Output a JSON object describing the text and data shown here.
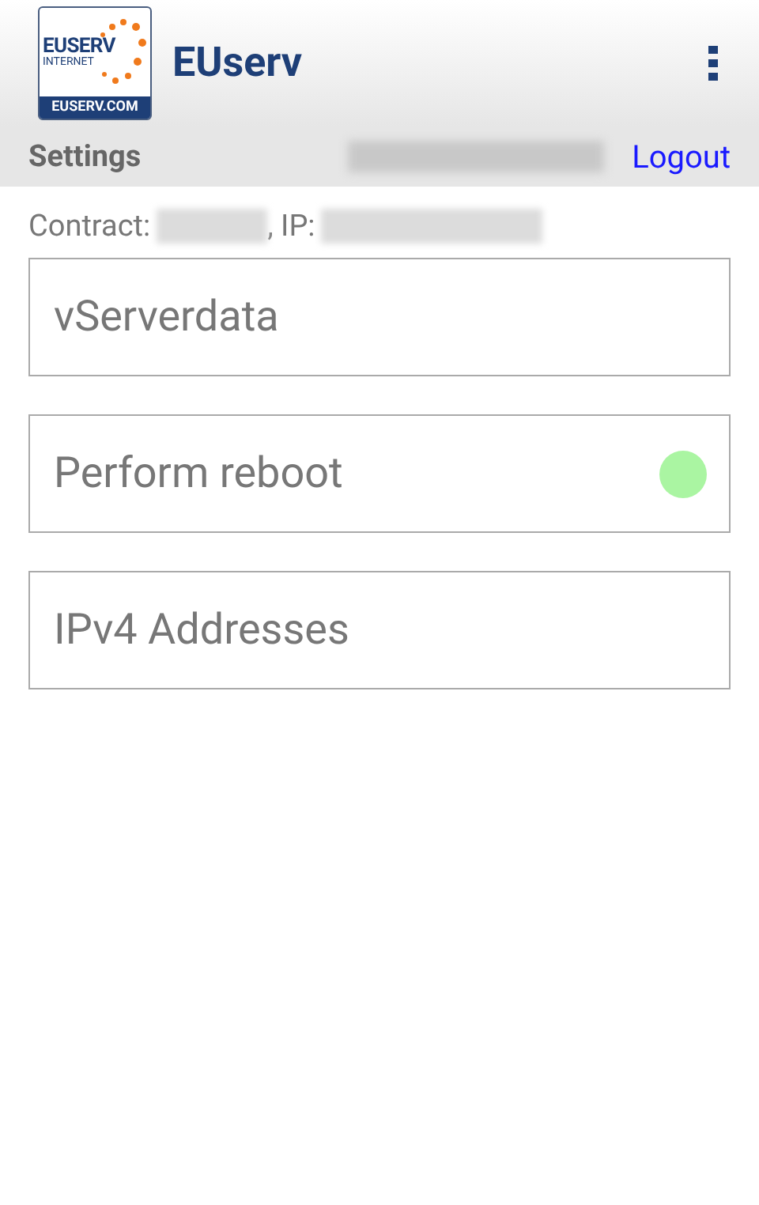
{
  "header": {
    "logo": {
      "wordmark": "EUSERV",
      "tagline": "INTERNET",
      "domain": "EUSERV.COM"
    },
    "title": "EUserv"
  },
  "subheader": {
    "title": "Settings",
    "logout": "Logout"
  },
  "contract": {
    "contract_label": "Contract:",
    "ip_label": ", IP:"
  },
  "items": [
    {
      "label": "vServerdata"
    },
    {
      "label": "Perform reboot",
      "color": "#aaf5a2"
    },
    {
      "label": "IPv4 Addresses"
    }
  ]
}
